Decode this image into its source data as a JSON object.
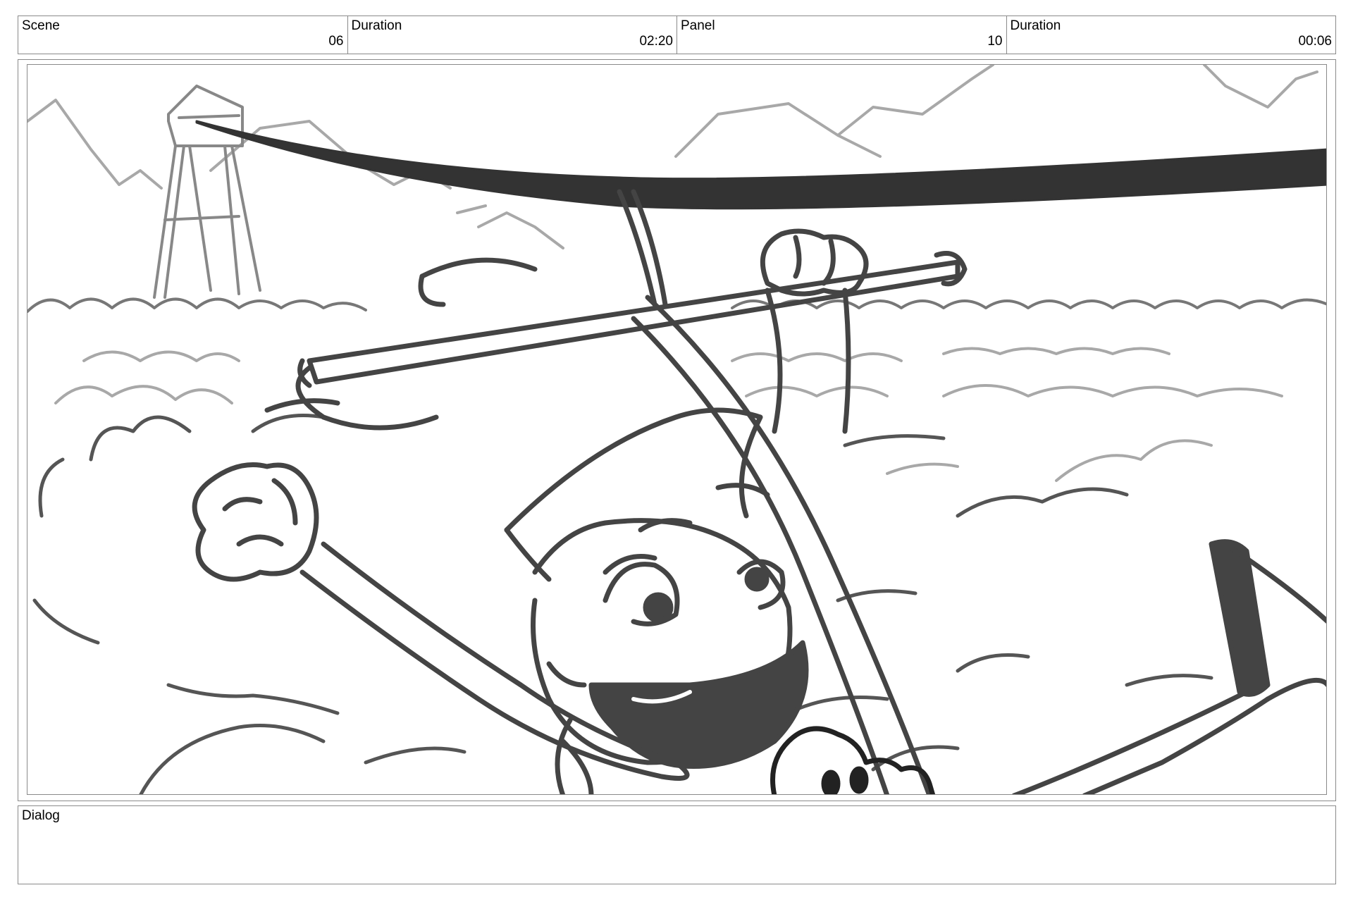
{
  "header": {
    "cells": [
      {
        "label": "Scene",
        "value": "06"
      },
      {
        "label": "Duration",
        "value": "02:20"
      },
      {
        "label": "Panel",
        "value": "10"
      },
      {
        "label": "Duration",
        "value": "00:06"
      }
    ]
  },
  "dialog": {
    "label": "Dialog",
    "text": ""
  },
  "colors": {
    "border": "#8a8a8a",
    "ink_dark": "#333333",
    "ink_mid": "#555555",
    "ink_light": "#a0a0a0"
  }
}
